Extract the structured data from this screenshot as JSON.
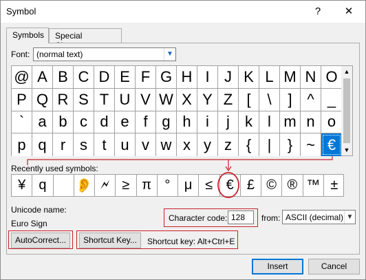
{
  "window": {
    "title": "Symbol",
    "help_label": "?",
    "close_label": "✕"
  },
  "tabs": [
    {
      "label": "Symbols",
      "active": true
    },
    {
      "label": "Special Characters",
      "active": false
    }
  ],
  "font": {
    "label": "Font:",
    "value": "(normal text)"
  },
  "symbol_grid": [
    [
      "@",
      "A",
      "B",
      "C",
      "D",
      "E",
      "F",
      "G",
      "H",
      "I",
      "J",
      "K",
      "L",
      "M",
      "N",
      "O"
    ],
    [
      "P",
      "Q",
      "R",
      "S",
      "T",
      "U",
      "V",
      "W",
      "X",
      "Y",
      "Z",
      "[",
      "\\",
      "]",
      "^",
      "_"
    ],
    [
      "`",
      "a",
      "b",
      "c",
      "d",
      "e",
      "f",
      "g",
      "h",
      "i",
      "j",
      "k",
      "l",
      "m",
      "n",
      "o"
    ],
    [
      "p",
      "q",
      "r",
      "s",
      "t",
      "u",
      "v",
      "w",
      "x",
      "y",
      "z",
      "{",
      "|",
      "}",
      "~",
      "€"
    ]
  ],
  "selected_symbol": "€",
  "recent": {
    "label": "Recently used symbols:",
    "symbols": [
      "¥",
      "q",
      "",
      "👂",
      "🗲",
      "≥",
      "π",
      "°",
      "μ",
      "≤",
      "€",
      "£",
      "©",
      "®",
      "™",
      "±"
    ]
  },
  "unicode": {
    "label": "Unicode name:",
    "value": "Euro Sign"
  },
  "char_code": {
    "label": "Character code:",
    "value": "128"
  },
  "from": {
    "label": "from:",
    "value": "ASCII (decimal)"
  },
  "buttons": {
    "autocorrect": "AutoCorrect...",
    "shortcut_key": "Shortcut Key...",
    "insert": "Insert",
    "cancel": "Cancel"
  },
  "shortcut_text": "Shortcut key: Alt+Ctrl+E",
  "colors": {
    "selection": "#0078d7",
    "annotation_red": "#c8202a"
  }
}
